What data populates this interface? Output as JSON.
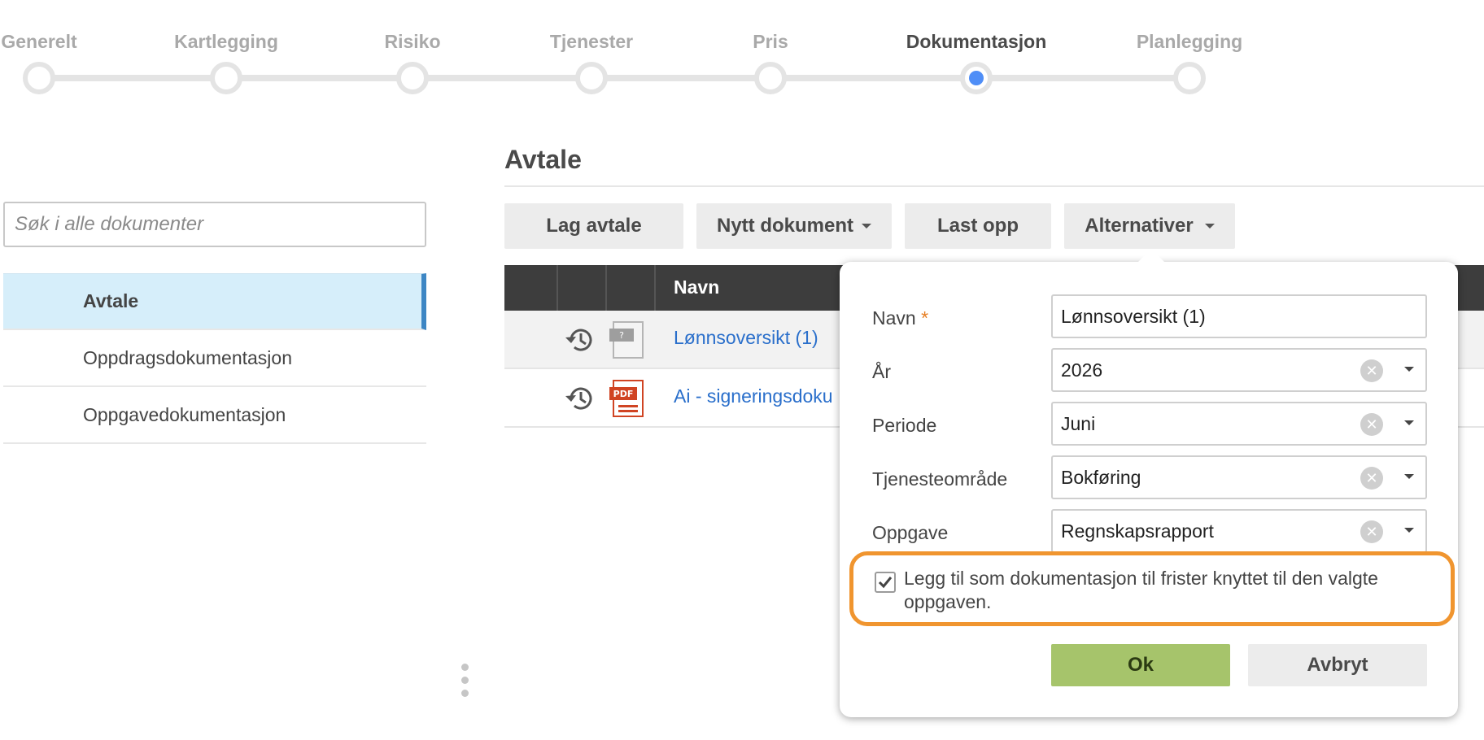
{
  "stepper": {
    "steps": [
      {
        "label": "Generelt",
        "active": false
      },
      {
        "label": "Kartlegging",
        "active": false
      },
      {
        "label": "Risiko",
        "active": false
      },
      {
        "label": "Tjenester",
        "active": false
      },
      {
        "label": "Pris",
        "active": false
      },
      {
        "label": "Dokumentasjon",
        "active": true
      },
      {
        "label": "Planlegging",
        "active": false
      }
    ],
    "active_color": "#4f8ef7"
  },
  "sidebar": {
    "search_placeholder": "Søk i alle dokumenter",
    "items": [
      {
        "label": "Avtale",
        "selected": true
      },
      {
        "label": "Oppdragsdokumentasjon",
        "selected": false
      },
      {
        "label": "Oppgavedokumentasjon",
        "selected": false
      }
    ]
  },
  "main": {
    "title": "Avtale",
    "toolbar": {
      "create_label": "Lag avtale",
      "new_doc_label": "Nytt dokument",
      "upload_label": "Last opp",
      "options_label": "Alternativer"
    },
    "table": {
      "name_header": "Navn",
      "rows": [
        {
          "name": "Lønnsoversikt (1)",
          "file_icon": "unknown-file-icon"
        },
        {
          "name": "Ai - signeringsdoku",
          "file_icon": "pdf-file-icon"
        }
      ]
    }
  },
  "dialog": {
    "name_label": "Navn",
    "required_mark": "*",
    "name_value": "Lønnsoversikt (1)",
    "year_label": "År",
    "year_value": "2026",
    "period_label": "Periode",
    "period_value": "Juni",
    "service_label": "Tjenesteområde",
    "service_value": "Bokføring",
    "task_label": "Oppgave",
    "task_value": "Regnskapsrapport",
    "checkbox_checked": true,
    "checkbox_text": "Legg til som dokumentasjon til frister knyttet til den valgte oppgaven.",
    "ok_label": "Ok",
    "cancel_label": "Avbryt",
    "highlight_color": "#f0952f",
    "ok_color": "#a6c46b"
  }
}
